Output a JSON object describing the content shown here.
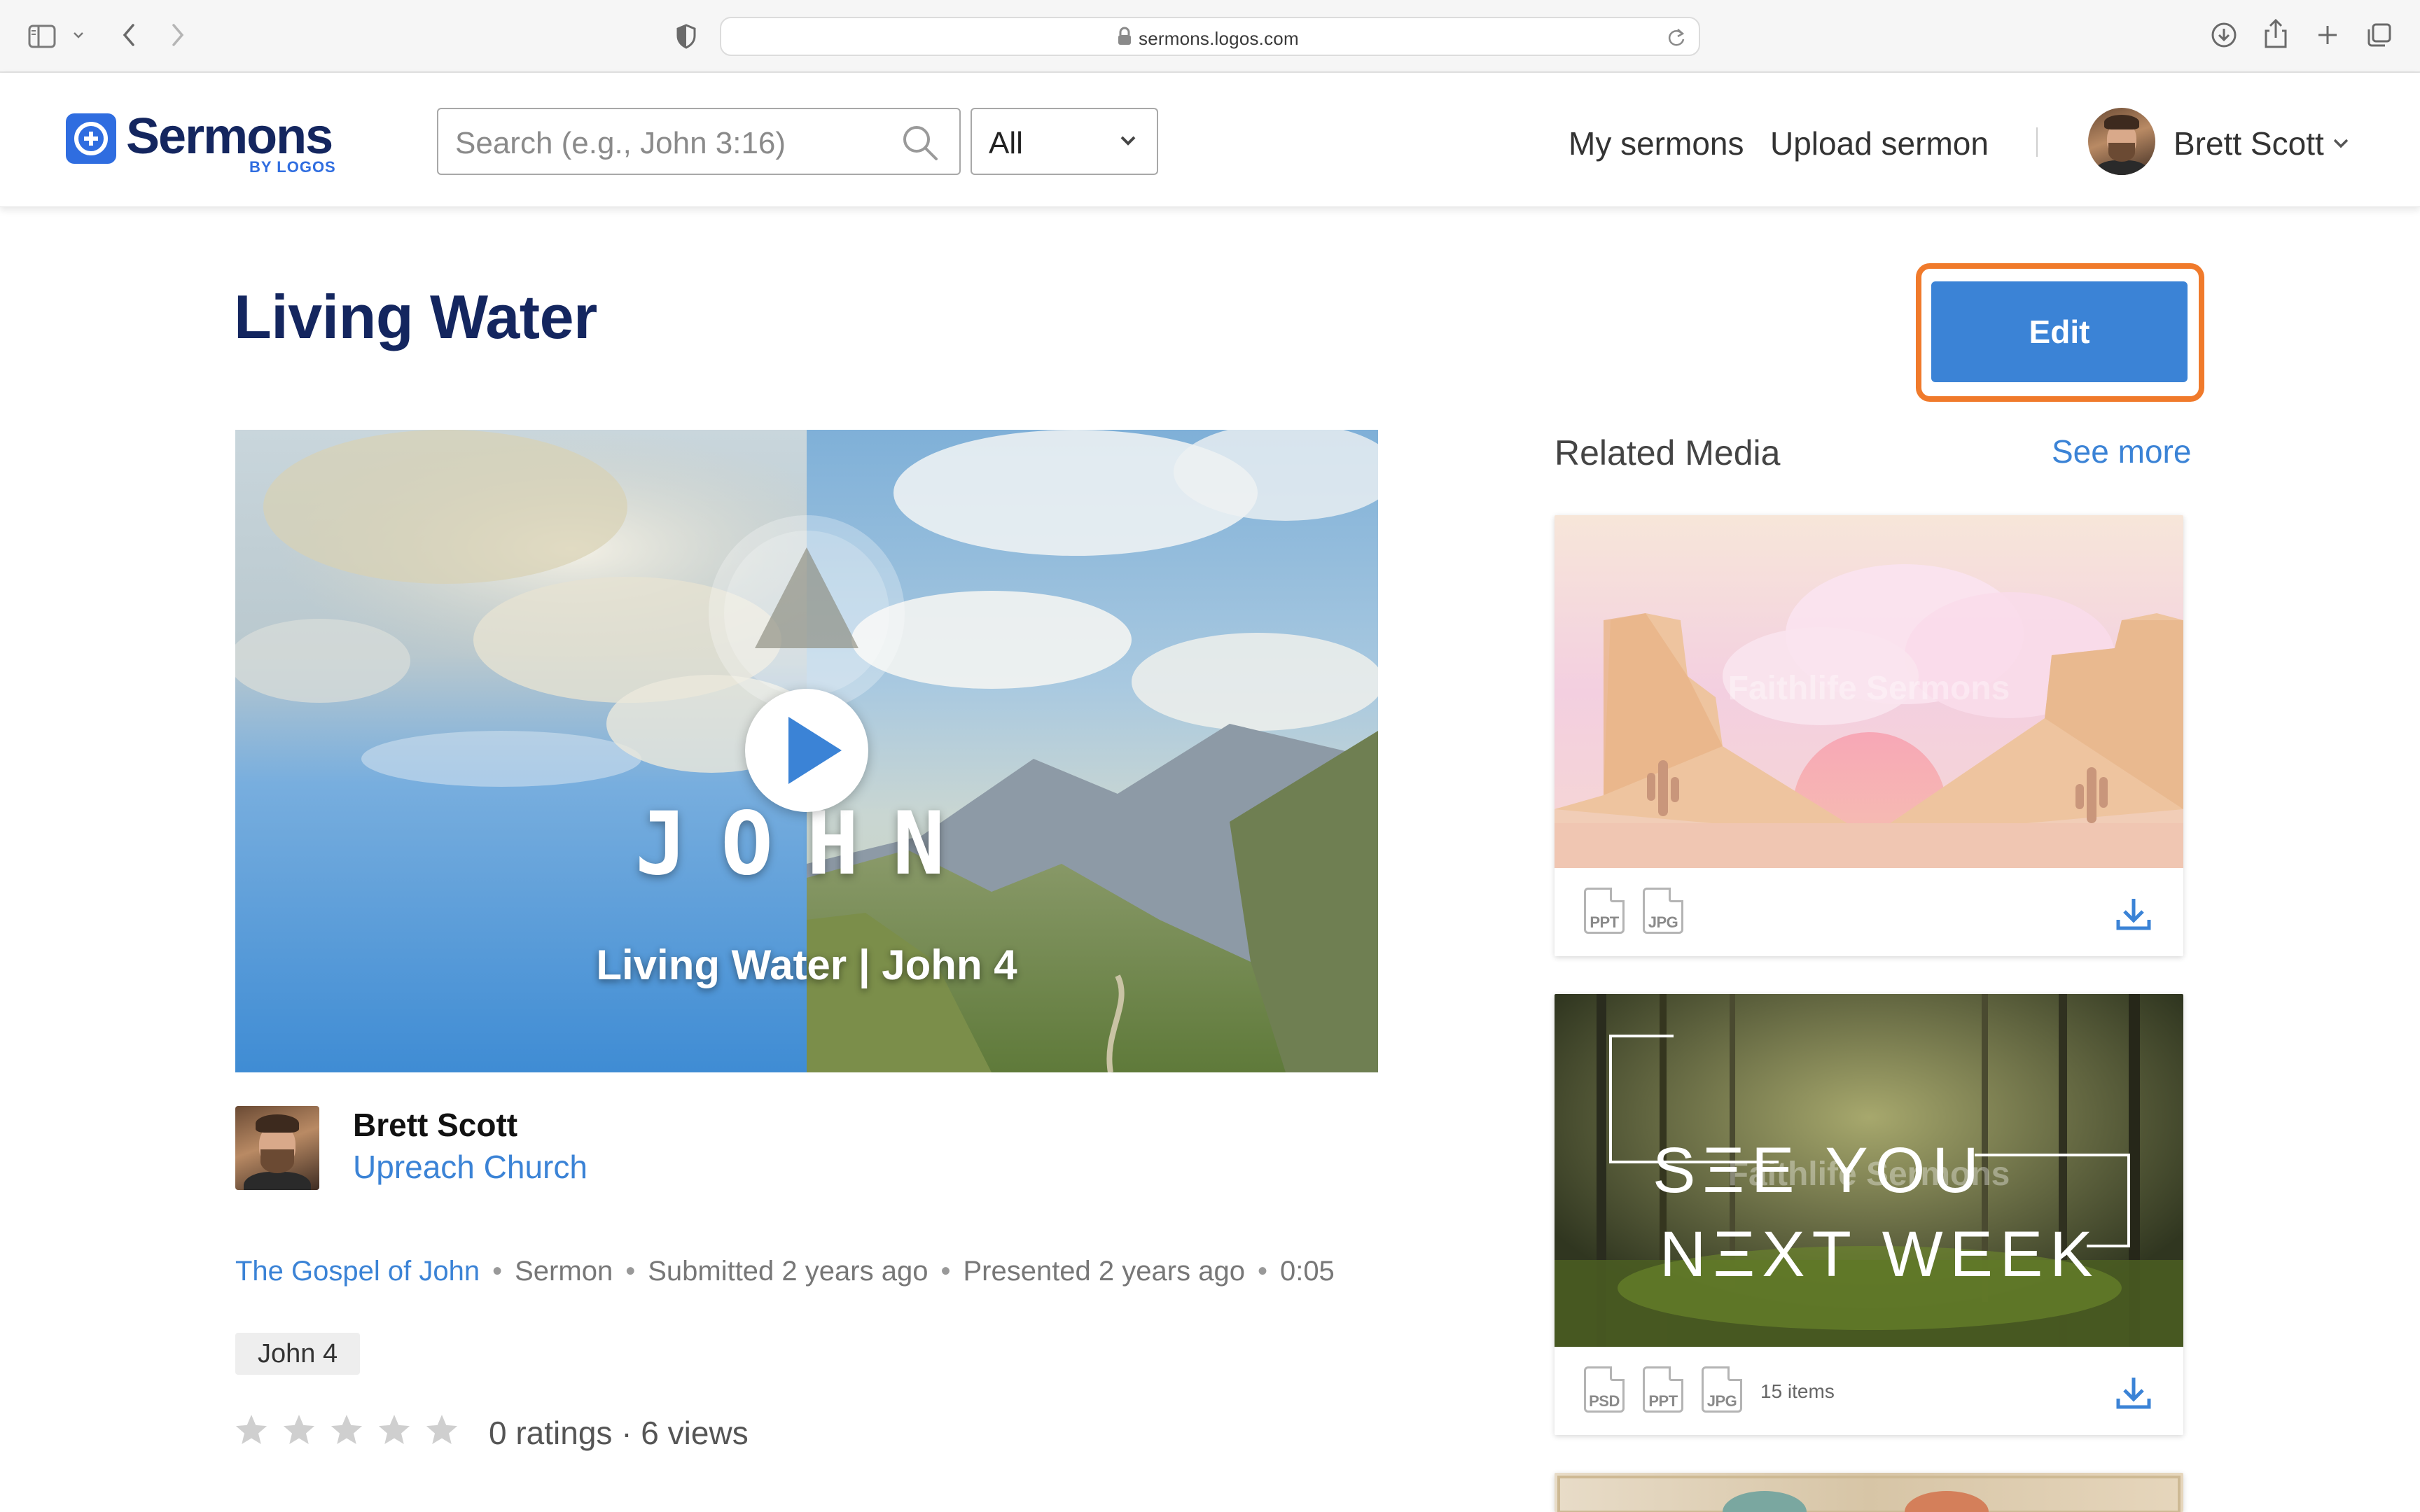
{
  "browser": {
    "url": "sermons.logos.com"
  },
  "header": {
    "logo_text": "Sermons",
    "logo_sub": "BY LOGOS",
    "search_placeholder": "Search (e.g., John 3:16)",
    "scope_value": "All",
    "nav": {
      "my_sermons": "My sermons",
      "upload_sermon": "Upload sermon"
    },
    "user_name": "Brett Scott"
  },
  "sermon": {
    "title": "Living Water",
    "edit_label": "Edit",
    "hero_title": "JOHN",
    "hero_subtitle": "Living Water | John 4",
    "author_name": "Brett Scott",
    "church": "Upreach Church",
    "meta": {
      "series": "The Gospel of John",
      "type": "Sermon",
      "submitted": "Submitted 2 years ago",
      "presented": "Presented 2 years ago",
      "duration": "0:05"
    },
    "tag": "John 4",
    "rating_stars": 0,
    "ratings_summary": "0 ratings · 6 views"
  },
  "related": {
    "title": "Related Media",
    "see_more": "See more",
    "watermark": "Faithlife Sermons",
    "cards": [
      {
        "formats": [
          "PPT",
          "JPG"
        ]
      },
      {
        "headline_1": "SΞE YOU",
        "headline_2": "NΞXT WEEK",
        "formats": [
          "PSD",
          "PPT",
          "JPG"
        ],
        "item_count": "15 items"
      }
    ]
  },
  "colors": {
    "brand_navy": "#14265f",
    "brand_blue": "#3b83d6",
    "highlight_orange": "#f07a2b"
  }
}
